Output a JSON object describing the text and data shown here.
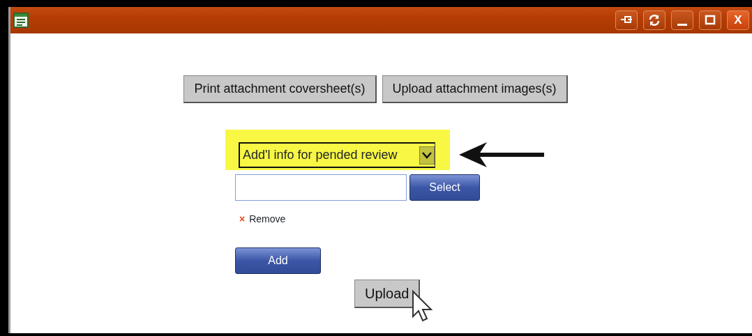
{
  "window": {
    "title_controls": [
      {
        "kind": "pin"
      },
      {
        "kind": "refresh"
      },
      {
        "kind": "minimize"
      },
      {
        "kind": "maximize"
      },
      {
        "kind": "close",
        "label": "X"
      }
    ]
  },
  "top_buttons": [
    "Print attachment coversheet(s)",
    "Upload attachment images(s)"
  ],
  "category_select": {
    "value": "Add'l info for pended review",
    "highlighted": true
  },
  "file_field": {
    "button": "Select"
  },
  "remove_link": {
    "icon": "×",
    "label": "Remove"
  },
  "add_button": "Add",
  "upload_button": "Upload"
}
